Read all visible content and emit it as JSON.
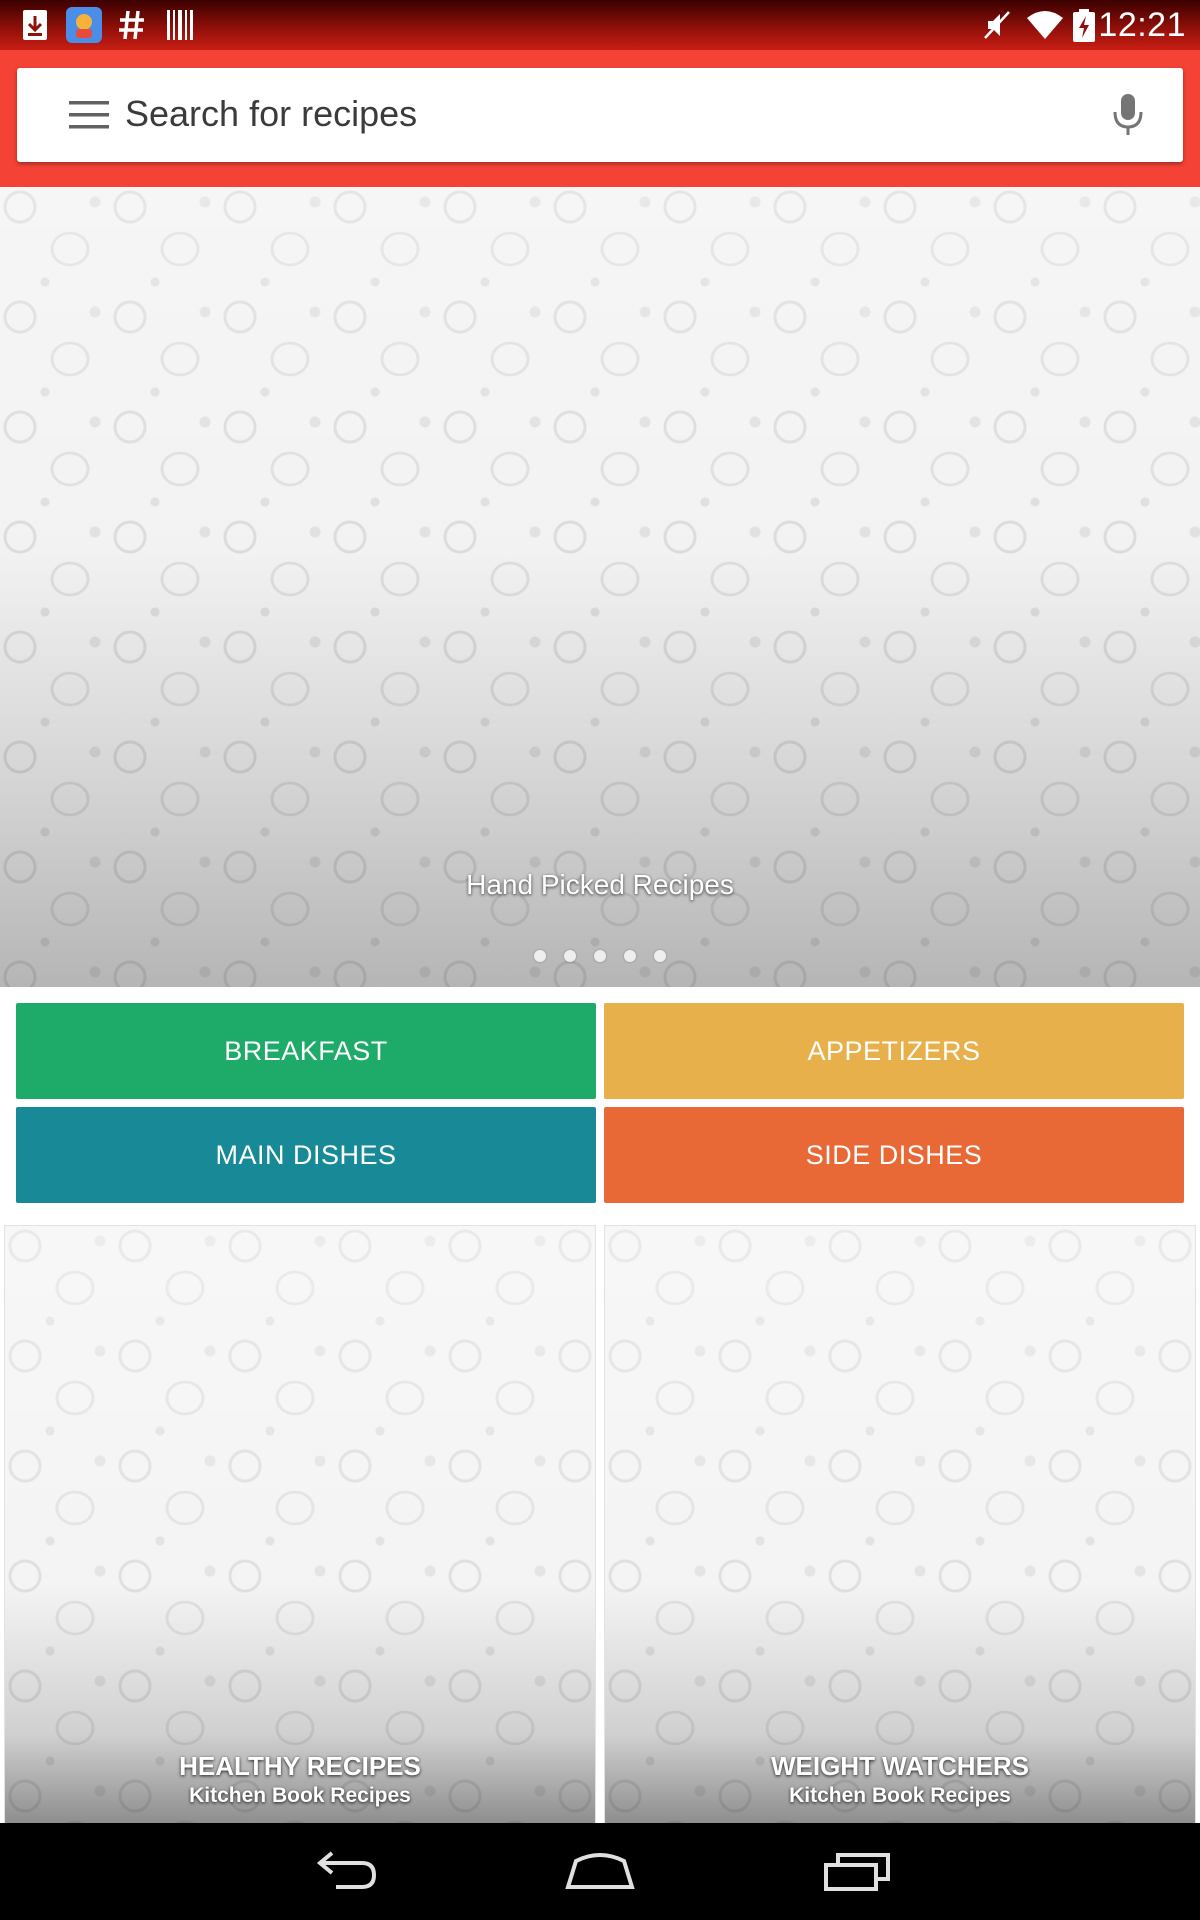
{
  "status_bar": {
    "time": "12:21",
    "left_icons": [
      "download-icon",
      "app-notification-icon",
      "hashtag-icon",
      "barcode-icon"
    ],
    "right_icons": [
      "vibrate-mute-icon",
      "wifi-icon",
      "battery-charging-icon"
    ]
  },
  "search": {
    "placeholder": "Search for recipes",
    "menu_icon": "hamburger-menu-icon",
    "mic_icon": "microphone-icon"
  },
  "hero": {
    "caption": "Hand Picked Recipes",
    "slide_count": 5,
    "active_slide": 1
  },
  "categories": [
    {
      "label": "BREAKFAST",
      "color": "#1eab6a"
    },
    {
      "label": "APPETIZERS",
      "color": "#e8b04a"
    },
    {
      "label": "MAIN DISHES",
      "color": "#188a97"
    },
    {
      "label": "SIDE DISHES",
      "color": "#e86836"
    }
  ],
  "collections": [
    {
      "title": "HEALTHY RECIPES",
      "subtitle": "Kitchen Book Recipes"
    },
    {
      "title": "WEIGHT WATCHERS",
      "subtitle": "Kitchen Book Recipes"
    }
  ],
  "nav": {
    "buttons": [
      "back-icon",
      "home-icon",
      "recent-apps-icon"
    ]
  },
  "colors": {
    "app_bar": "#f44336",
    "status_bar": "#b71c1c"
  }
}
